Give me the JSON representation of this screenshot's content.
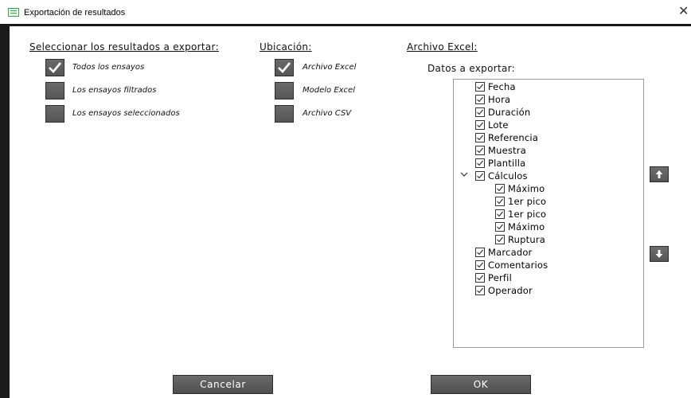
{
  "window": {
    "title": "Exportación de resultados",
    "close_glyph": "✕",
    "app_icon": "table-icon"
  },
  "select": {
    "heading": "Seleccionar los resultados a exportar:",
    "options": [
      {
        "label": "Todos los ensayos",
        "checked": true
      },
      {
        "label": "Los ensayos filtrados",
        "checked": false
      },
      {
        "label": "Los ensayos seleccionados",
        "checked": false
      }
    ]
  },
  "location": {
    "heading": "Ubicación:",
    "options": [
      {
        "label": "Archivo Excel",
        "checked": true
      },
      {
        "label": "Modelo Excel",
        "checked": false
      },
      {
        "label": "Archivo CSV",
        "checked": false
      }
    ]
  },
  "excel": {
    "heading": "Archivo Excel:",
    "data_label": "Datos a exportar:",
    "tree": [
      {
        "label": "Fecha",
        "checked": true
      },
      {
        "label": "Hora",
        "checked": true
      },
      {
        "label": "Duración",
        "checked": true
      },
      {
        "label": "Lote",
        "checked": true
      },
      {
        "label": "Referencia",
        "checked": true
      },
      {
        "label": "Muestra",
        "checked": true
      },
      {
        "label": "Plantilla",
        "checked": true
      },
      {
        "label": "Cálculos",
        "checked": true,
        "expanded": true,
        "children": [
          {
            "label": "Máximo",
            "checked": true
          },
          {
            "label": "1er pico",
            "checked": true
          },
          {
            "label": "1er pico",
            "checked": true
          },
          {
            "label": "Máximo",
            "checked": true
          },
          {
            "label": "Ruptura",
            "checked": true
          }
        ]
      },
      {
        "label": "Marcador",
        "checked": true
      },
      {
        "label": "Comentarios",
        "checked": true
      },
      {
        "label": "Perfil",
        "checked": true
      },
      {
        "label": "Operador",
        "checked": true
      }
    ],
    "move_up_icon": "arrow-up-icon",
    "move_down_icon": "arrow-down-icon"
  },
  "buttons": {
    "cancel": "Cancelar",
    "ok": "OK"
  },
  "colors": {
    "frame": "#1a1a1a",
    "button_dark": "#5a5a5a",
    "button_text": "#ffffff"
  }
}
